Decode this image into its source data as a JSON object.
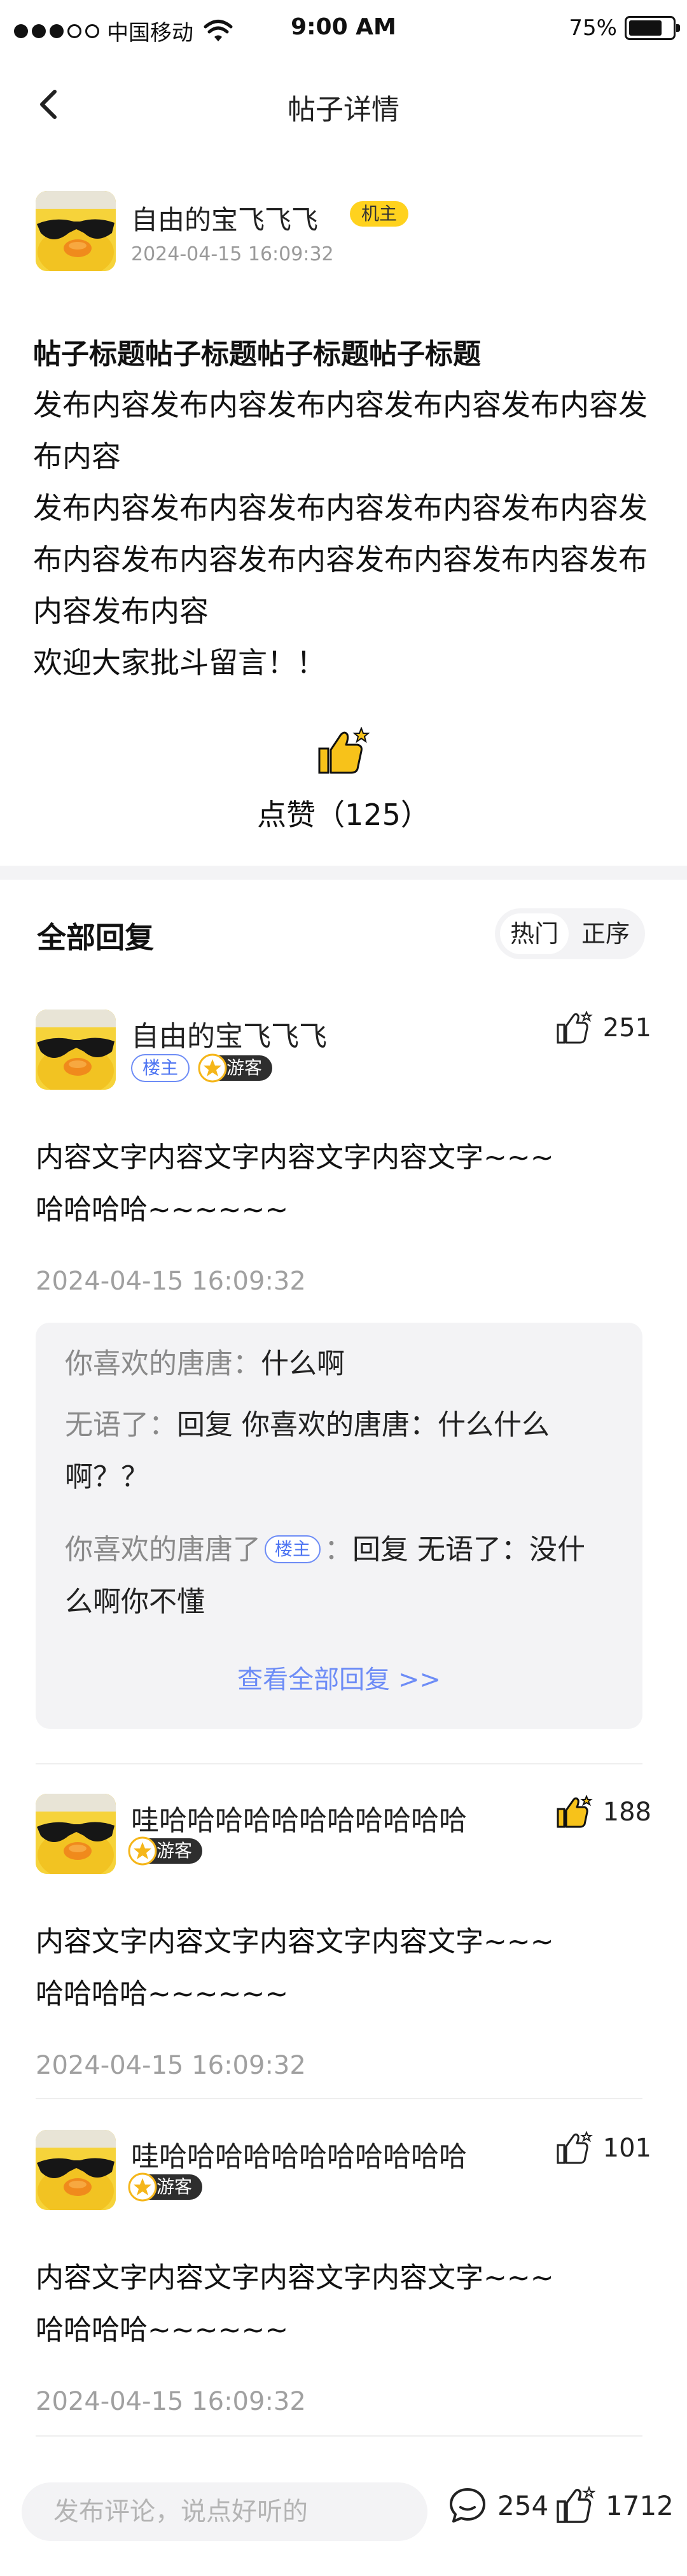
{
  "status_bar": {
    "carrier": "中国移动",
    "time": "9:00 AM",
    "battery": "75%",
    "battery_level": 0.75
  },
  "nav": {
    "title": "帖子详情"
  },
  "post": {
    "author": "自由的宝飞飞飞",
    "owner_tag": "机主",
    "time": "2024-04-15  16:09:32",
    "title": "帖子标题帖子标题帖子标题帖子标题",
    "body": "发布内容发布内容发布内容发布内容发布内容发布内容\n发布内容发布内容发布内容发布内容发布内容发布内容发布内容发布内容发布内容发布内容发布内容发布内容\n欢迎大家批斗留言！！",
    "like_label": "点赞（125）"
  },
  "replies": {
    "title": "全部回复",
    "sort": {
      "hot": "热门",
      "order": "正序",
      "active": "hot"
    }
  },
  "comments": [
    {
      "name": "自由的宝飞飞飞",
      "badge_lz": "楼主",
      "badge_guest": "游客",
      "likes": "251",
      "liked": false,
      "text": "内容文字内容文字内容文字内容文字~~~\n哈哈哈哈~~~~~~",
      "time": "2024-04-15  16:09:32",
      "sub_replies": [
        {
          "who": "你喜欢的唐唐：",
          "text": "什么啊"
        },
        {
          "who": "无语了：",
          "text": "回复 你喜欢的唐唐：什么什么啊？？"
        },
        {
          "who": "你喜欢的唐唐了",
          "lz": "楼主",
          "sep": "：",
          "text": "回复 无语了：没什么啊你不懂"
        }
      ],
      "see_all": "查看全部回复 >>"
    },
    {
      "name": "哇哈哈哈哈哈哈哈哈哈哈哈",
      "badge_guest": "游客",
      "likes": "188",
      "liked": true,
      "text": "内容文字内容文字内容文字内容文字~~~\n哈哈哈哈~~~~~~",
      "time": "2024-04-15  16:09:32"
    },
    {
      "name": "哇哈哈哈哈哈哈哈哈哈哈哈",
      "badge_guest": "游客",
      "likes": "101",
      "liked": false,
      "text": "内容文字内容文字内容文字内容文字~~~\n哈哈哈哈~~~~~~",
      "time": "2024-04-15  16:09:32"
    }
  ],
  "bottom_bar": {
    "placeholder": "发布评论，说点好听的",
    "comment_count": "254",
    "like_count": "1712"
  },
  "colors": {
    "accent_yellow": "#ffd21e",
    "link_blue": "#6d8cf6",
    "muted": "#a0a0a0"
  }
}
